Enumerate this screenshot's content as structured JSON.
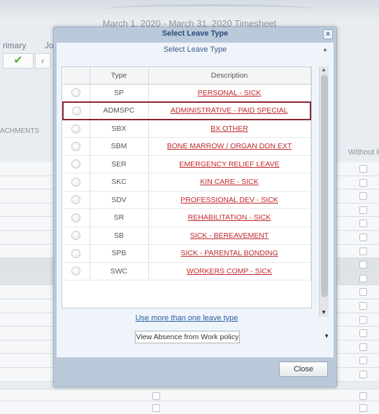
{
  "background": {
    "title": "March 1, 2020 - March 31, 2020 Timesheet",
    "primary_label": "rimary",
    "job_label": "Jo",
    "attachments_label": "ACHMENTS",
    "without_label": "Without F",
    "check_glyph": "✔",
    "icon_glyph": "‹"
  },
  "modal": {
    "title": "Select Leave Type",
    "close_glyph": "×",
    "subtitle": "Select Leave Type",
    "columns": {
      "type": "Type",
      "description": "Description"
    },
    "rows": [
      {
        "type": "SP",
        "description": "PERSONAL - SICK"
      },
      {
        "type": "ADMSPC",
        "description": "ADMINISTRATIVE - PAID SPECIAL"
      },
      {
        "type": "SBX",
        "description": "BX OTHER"
      },
      {
        "type": "SBM",
        "description": "BONE MARROW / ORGAN DON EXT"
      },
      {
        "type": "SER",
        "description": "EMERGENCY RELIEF LEAVE"
      },
      {
        "type": "SKC",
        "description": "KIN CARE - SICK"
      },
      {
        "type": "SDV",
        "description": "PROFESSIONAL DEV - SICK"
      },
      {
        "type": "SR",
        "description": "REHABILITATION - SICK"
      },
      {
        "type": "SB",
        "description": "SICK - BEREAVEMENT"
      },
      {
        "type": "SPB",
        "description": "SICK - PARENTAL BONDING"
      },
      {
        "type": "SWC",
        "description": "WORKERS COMP - SICK"
      }
    ],
    "highlighted_row": "ADMSPC",
    "multi_link": "Use more than one leave type",
    "policy_button": "View Absence from Work policy",
    "close_button": "Close"
  },
  "colors": {
    "description_text": "#c0282c",
    "highlight_border": "#8a2430",
    "link": "#2a5ea8",
    "check": "#58b144"
  }
}
